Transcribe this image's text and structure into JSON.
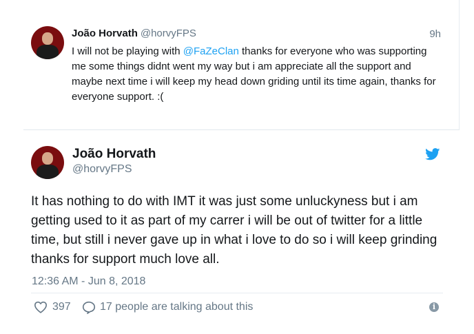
{
  "parent_tweet": {
    "author_name": "João Horvath",
    "author_handle": "@horvyFPS",
    "time": "9h",
    "text_before_mention": "I will not be playing with ",
    "mention": "@FaZeClan",
    "text_after_mention": " thanks for everyone who was supporting me some things didnt went my way but i am appreciate all the support and maybe next time i will keep my head down griding until its time again, thanks for everyone support. :("
  },
  "main_tweet": {
    "author_name": "João Horvath",
    "author_handle": "@horvyFPS",
    "text": "It has nothing to do with IMT it was just some unluckyness but i am getting used to it as part of my carrer i will be out of twitter for a little time, but still i never gave up in what i love to do so i will keep grinding thanks for support much love all.",
    "date": "12:36 AM - Jun 8, 2018",
    "like_count": "397",
    "talking_text": "17 people are talking about this",
    "info_glyph": "i"
  },
  "icons": {
    "brand": "twitter-bird-icon",
    "like": "heart-icon",
    "reply": "speech-bubble-icon",
    "info": "info-icon"
  },
  "colors": {
    "link": "#1da1f2",
    "secondary_text": "#657786",
    "primary_text": "#14171a",
    "border": "#e6ecf0"
  }
}
